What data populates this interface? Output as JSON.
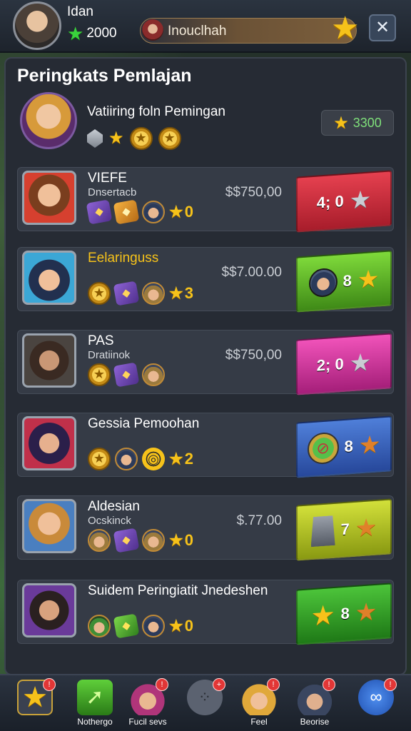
{
  "topbar": {
    "player_name": "Idan",
    "currency": "2000",
    "quest_label": "Inouclhah",
    "close_glyph": "✕"
  },
  "panel": {
    "title": "Peringkats Pemlajan",
    "subtitle": "Vatiiring foln Pemingan",
    "score": "3300"
  },
  "rows": [
    {
      "name": "VIEFE",
      "sub": "Dnsertacb",
      "price": "$$750,00",
      "stars": "0",
      "action": "4; 0",
      "color": "#e5404f"
    },
    {
      "name": "Eelaringuss",
      "sub": "",
      "price": "$$7.00.00",
      "stars": "3",
      "action": "8",
      "color": "#7ed93a"
    },
    {
      "name": "PAS",
      "sub": "Dratiinok",
      "price": "$$750,00",
      "stars": "",
      "action": "2; 0",
      "color": "#f052b9"
    },
    {
      "name": "Gessia Pemoohan",
      "sub": "",
      "price": "",
      "stars": "2",
      "action": "8",
      "color": "#4f7fd9"
    },
    {
      "name": "Aldesian",
      "sub": "Ocskinck",
      "price": "$.77.00",
      "stars": "0",
      "action": "7",
      "color": "#d2e03a"
    },
    {
      "name": "Suidem Peringiatit  Jnedeshen",
      "sub": "",
      "price": "",
      "stars": "0",
      "action": "8",
      "color": "#4cc43a"
    }
  ],
  "bottom_nav": [
    {
      "label": "",
      "badge": "!",
      "icon": "gold-star-icon"
    },
    {
      "label": "Nothergo",
      "badge": "",
      "icon": "green-arrow-icon"
    },
    {
      "label": "Fucil sevs",
      "badge": "!",
      "icon": "character-icon"
    },
    {
      "label": "",
      "badge": "+",
      "icon": "dots-icon"
    },
    {
      "label": "Feel",
      "badge": "!",
      "icon": "hero-icon"
    },
    {
      "label": "Beorise",
      "badge": "!",
      "icon": "helmet-icon"
    },
    {
      "label": "",
      "badge": "!",
      "icon": "bone-icon"
    }
  ]
}
